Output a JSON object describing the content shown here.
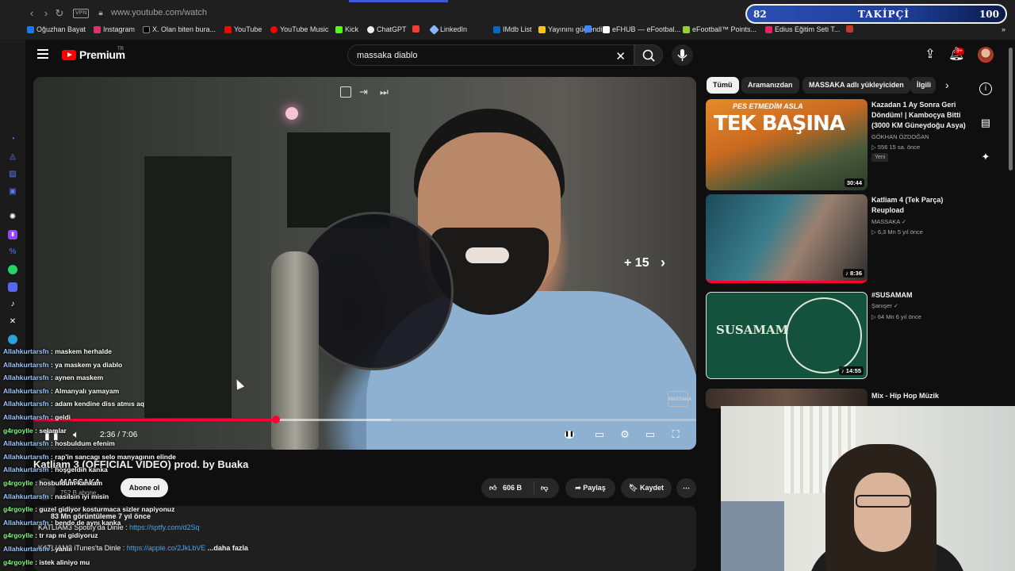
{
  "browser": {
    "url": "www.youtube.com/watch",
    "vpn_label": "VPN",
    "bookmarks": [
      "Oğuzhan Bayat",
      "Instagram",
      "X. Olan biten bura...",
      "YouTube",
      "YouTube Music",
      "Kick",
      "ChatGPT",
      "LinkedIn",
      "IMdb List",
      "Yayınını güçlendir...",
      "eFHUB — eFootbal...",
      "eFootball™ Points...",
      "Edius Eğitim Seti T..."
    ]
  },
  "follower_goal": {
    "count": "82",
    "label": "TAKİPÇİ",
    "goal": "100"
  },
  "header": {
    "logo_text": "Premium",
    "logo_region": "TR",
    "search_value": "massaka diablo",
    "notification_count": "9+"
  },
  "player": {
    "skip_label": "+ 15",
    "time": "2:36 / 7:06",
    "progress_fraction": 0.366,
    "buffer_fraction": 0.54,
    "watermark": "MASSAKA"
  },
  "video": {
    "title": "Katliam 3 (OFFICIAL VIDEO) prod. by Buaka",
    "channel": "MASSAKA",
    "subscribers": "752 B abone",
    "subscribe_label": "Abone ol",
    "likes": "606 B",
    "share_label": "Paylaş",
    "save_label": "Kaydet",
    "more_label": "⋯",
    "views": "83 Mn görüntüleme  7 yıl önce",
    "desc_line1_prefix": "KATLIAM3 Spotify'da Dinle : ",
    "desc_line1_link": "https://sptfy.com/d2Sq",
    "desc_line2_prefix": "KATLIAM3 iTunes'ta Dinle : ",
    "desc_line2_link": "https://apple.co/2JkLbVE",
    "desc_more": "...daha fazla"
  },
  "chat": [
    {
      "user": "Allahkurtarsfn",
      "msg": "maskem herhalde",
      "color": "blue"
    },
    {
      "user": "Allahkurtarsfn",
      "msg": "ya maskem ya diablo",
      "color": "blue"
    },
    {
      "user": "Allahkurtarsfn",
      "msg": "aynen maskem",
      "color": "blue"
    },
    {
      "user": "Allahkurtarsfn",
      "msg": "Almanyalı yamayam",
      "color": "blue"
    },
    {
      "user": "Allahkurtarsfn",
      "msg": "adam kendine diss atmıs aq",
      "color": "blue"
    },
    {
      "user": "Allahkurtarsfn",
      "msg": "geldi",
      "color": "blue"
    },
    {
      "user": "g4rgoylle",
      "msg": "selamlar",
      "color": "green"
    },
    {
      "user": "Allahkurtarsfn",
      "msg": "hosbuldum efenim",
      "color": "blue"
    },
    {
      "user": "Allahkurtarsfn",
      "msg": "rap'in sancagı selo manyagının elinde",
      "color": "blue"
    },
    {
      "user": "Allahkurtarsfn",
      "msg": "hoşgeldin kanka",
      "color": "blue"
    },
    {
      "user": "g4rgoylle",
      "msg": "hosbuldum kankam",
      "color": "green"
    },
    {
      "user": "Allahkurtarsfn",
      "msg": "nasılsın iyi misin",
      "color": "blue"
    },
    {
      "user": "g4rgoylle",
      "msg": "guzel gidiyor kosturmaca sizler napiyonuz",
      "color": "green"
    },
    {
      "user": "Allahkurtarsfn",
      "msg": "bende de aynı kanka",
      "color": "blue"
    },
    {
      "user": "g4rgoylle",
      "msg": "tr rap mi gidiyoruz",
      "color": "green"
    },
    {
      "user": "Allahkurtarsfn",
      "msg": "yanlıı",
      "color": "blue"
    },
    {
      "user": "g4rgoylle",
      "msg": "istek aliniyo mu",
      "color": "green"
    }
  ],
  "chips": [
    "Tümü",
    "Aramanızdan",
    "MASSAKA adlı yükleyiciden",
    "İlgili"
  ],
  "recommendations": [
    {
      "title": "Kazadan 1 Ay Sonra Geri Döndüm! | Kamboçya Bitti (3000 KM Güneydoğu Asya)",
      "channel": "GÖKHAN ÖZDOĞAN",
      "meta": "▷ 556  15 sa. önce",
      "duration": "30:44",
      "badge": "Yeni",
      "thumb_text1": "PES ETMEDİM ASLA",
      "thumb_text2": "TEK BAŞINA"
    },
    {
      "title": "Katliam 4 (Tek Parça) Reupload",
      "channel": "MASSAKA ✓",
      "meta": "▷ 6,3 Mn  5 yıl önce",
      "duration": "♪ 8:36"
    },
    {
      "title": "#SUSAMAM",
      "channel": "Şanışer ✓",
      "meta": "▷ 64 Mn  6 yıl önce",
      "duration": "♪ 14:55",
      "thumb_text1": "SUSAMAM"
    },
    {
      "title": "Mix - Hip Hop Müzik",
      "channel": "",
      "meta": ""
    }
  ],
  "colors": {
    "accent": "#ff0033",
    "brand": "#ff0000",
    "link": "#3ea6ff"
  }
}
